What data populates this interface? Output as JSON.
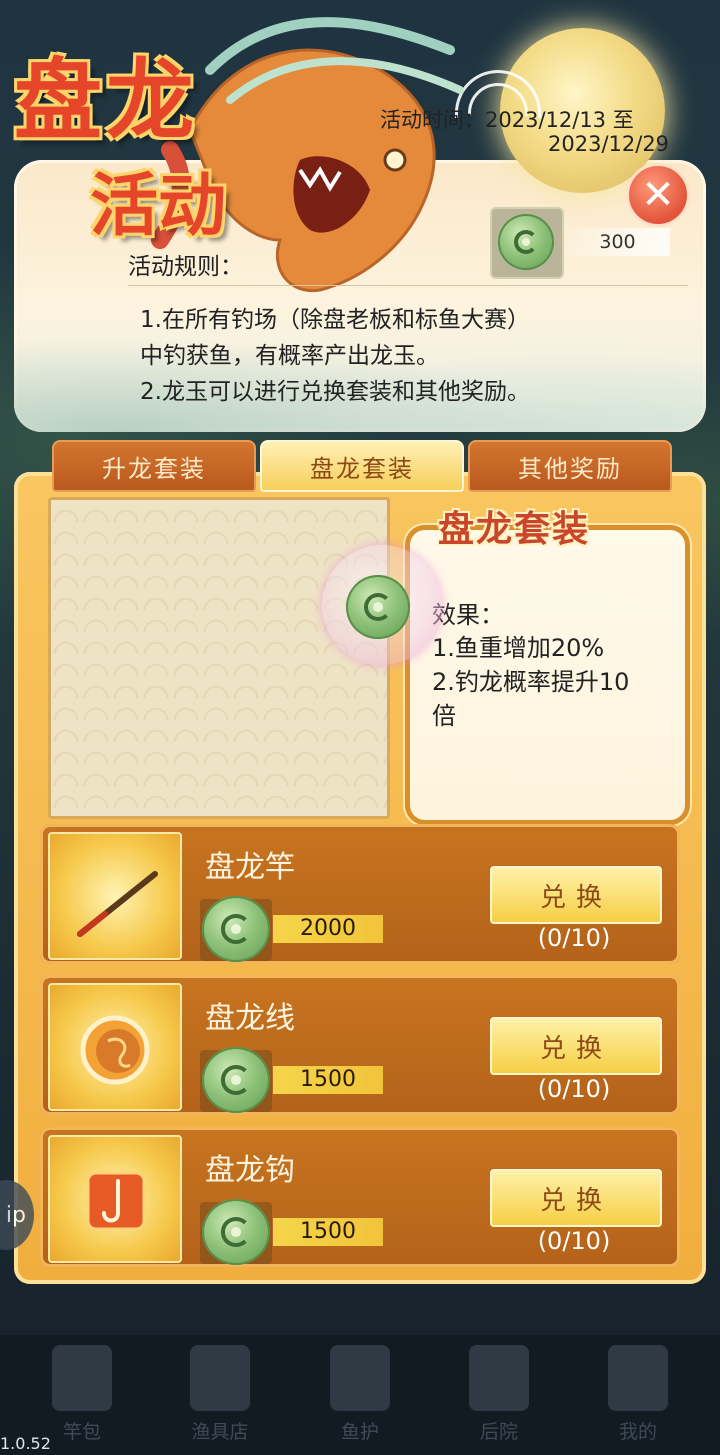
{
  "header": {
    "title_line1": "盘龙",
    "title_line2": "活动",
    "time_label": "活动时间：2023/12/13 至",
    "time_end": "2023/12/29",
    "currency_amount": "300",
    "rules_title": "活动规则：",
    "rules": [
      "1.在所有钓场（除盘老板和标鱼大赛）",
      "中钓获鱼，有概率产出龙玉。",
      "2.龙玉可以进行兑换套装和其他奖励。"
    ]
  },
  "tabs": [
    {
      "label": "升龙套装",
      "active": false
    },
    {
      "label": "盘龙套装",
      "active": true
    },
    {
      "label": "其他奖励",
      "active": false
    }
  ],
  "suit": {
    "title": "盘龙套装",
    "effect_title": "效果：",
    "effect_1": "1.鱼重增加20%",
    "effect_2a": "2.钓龙概率提升10",
    "effect_2b": "倍"
  },
  "items": [
    {
      "name": "盘龙竿",
      "cost": "2000",
      "button": "兑换",
      "progress": "(0/10)",
      "icon": "fishing-rod-icon"
    },
    {
      "name": "盘龙线",
      "cost": "1500",
      "button": "兑换",
      "progress": "(0/10)",
      "icon": "fishing-line-reel-icon"
    },
    {
      "name": "盘龙钩",
      "cost": "1500",
      "button": "兑换",
      "progress": "(0/10)",
      "icon": "fishing-hook-icon"
    }
  ],
  "nav": [
    {
      "label": "竿包",
      "icon": "rod-bag-icon"
    },
    {
      "label": "渔具店",
      "icon": "tackle-shop-icon"
    },
    {
      "label": "鱼护",
      "icon": "fish-keep-icon"
    },
    {
      "label": "后院",
      "icon": "backyard-sprout-icon"
    },
    {
      "label": "我的",
      "icon": "profile-icon"
    }
  ],
  "version": "1.0.52",
  "side_button": "ip",
  "colors": {
    "accent_red": "#e5462a",
    "gold": "#f6cf45",
    "panel": "#f1ae3e"
  }
}
